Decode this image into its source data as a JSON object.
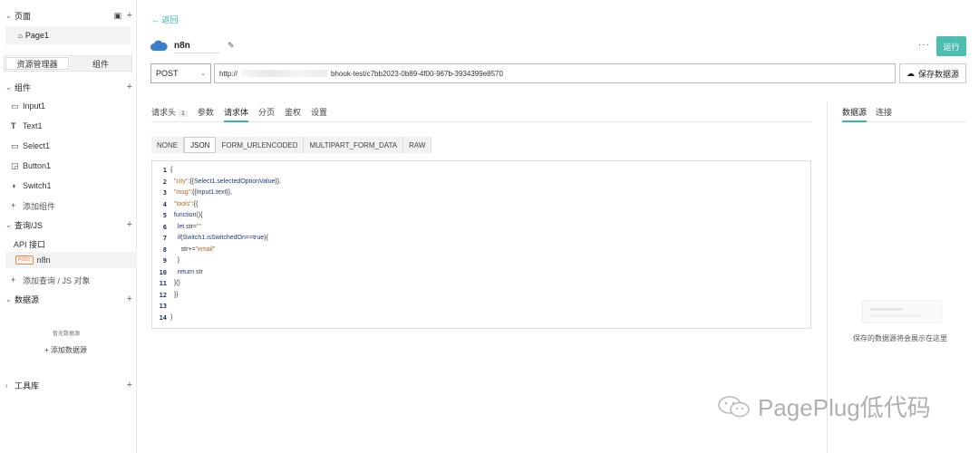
{
  "sidebar": {
    "pages_header": "页面",
    "page_item": "Page1",
    "tab_explorer": "资源管理器",
    "tab_widgets": "组件",
    "widgets_header": "组件",
    "widgets": [
      "Input1",
      "Text1",
      "Select1",
      "Button1",
      "Switch1"
    ],
    "add_widget": "添加组件",
    "query_header": "查询/JS",
    "api_label": "API 接口",
    "query_badge": "POST",
    "query_item": "n8n",
    "add_query": "添加查询 / JS 对象",
    "datasource_header": "数据源",
    "no_datasource": "暂无数据源",
    "add_datasource": "添加数据源",
    "library_header": "工具库"
  },
  "header": {
    "back": "返回",
    "api_name": "n8n",
    "run": "运行",
    "more": "···"
  },
  "request": {
    "method": "POST",
    "url_prefix": "http://",
    "url_suffix": "bhook-test/c7bb2023-0b89-4f00-967b-3934399e8570",
    "save_datasource": "保存数据源"
  },
  "tabs": {
    "headers": "请求头",
    "headers_count": "1",
    "params": "参数",
    "body": "请求体",
    "pagination": "分页",
    "auth": "鉴权",
    "settings": "设置"
  },
  "body_types": [
    "NONE",
    "JSON",
    "FORM_URLENCODED",
    "MULTIPART_FORM_DATA",
    "RAW"
  ],
  "right_panel": {
    "tab_datasource": "数据源",
    "tab_connect": "连接",
    "empty_text": "保存的数据源将会展示在这里"
  },
  "watermark": "PagePlug低代码"
}
